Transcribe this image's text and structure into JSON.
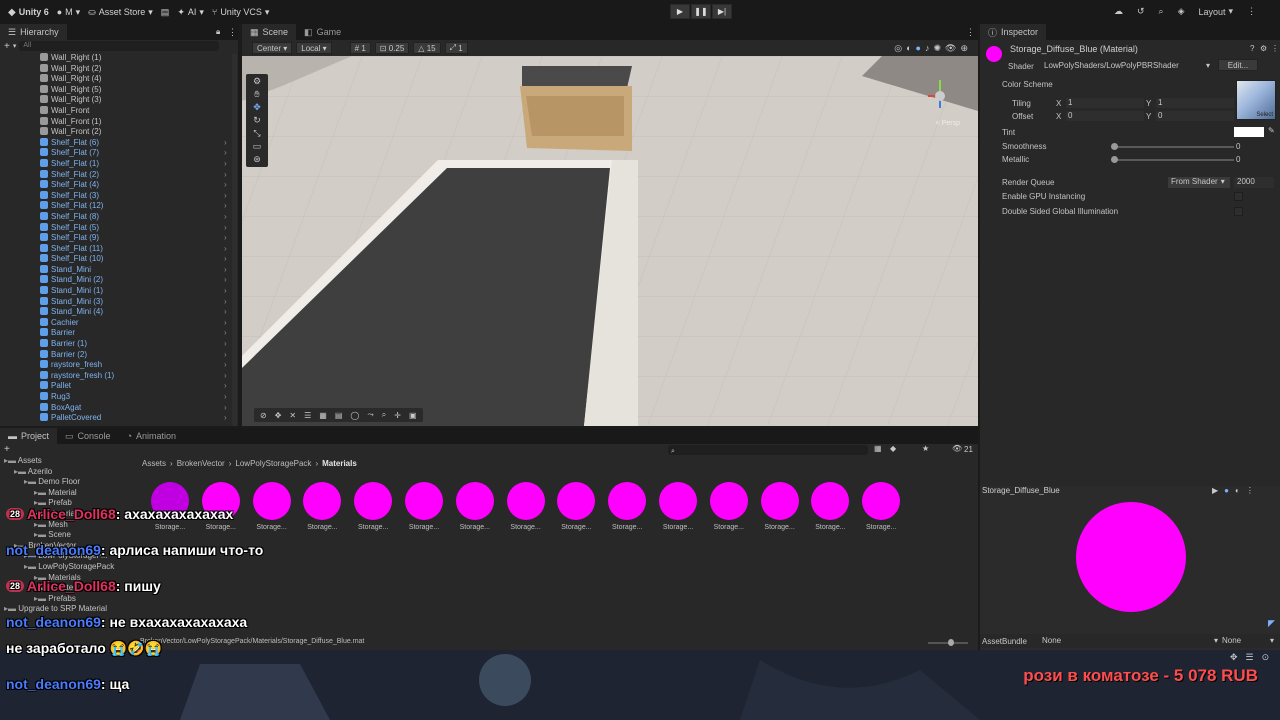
{
  "topbar": {
    "unity_label": "Unity 6",
    "account_label": "M",
    "asset_store_label": "Asset Store",
    "ai_label": "AI",
    "vcs_label": "Unity VCS",
    "layout_label": "Layout"
  },
  "hierarchy": {
    "tab": "Hierarchy",
    "search_placeholder": "All",
    "items": [
      {
        "label": "Wall_Right (1)",
        "type": "plain"
      },
      {
        "label": "Wall_Right (2)",
        "type": "plain"
      },
      {
        "label": "Wall_Right (4)",
        "type": "plain"
      },
      {
        "label": "Wall_Right (5)",
        "type": "plain"
      },
      {
        "label": "Wall_Right (3)",
        "type": "plain"
      },
      {
        "label": "Wall_Front",
        "type": "plain"
      },
      {
        "label": "Wall_Front (1)",
        "type": "plain"
      },
      {
        "label": "Wall_Front (2)",
        "type": "plain"
      },
      {
        "label": "Shelf_Flat (6)",
        "type": "prefab"
      },
      {
        "label": "Shelf_Flat (7)",
        "type": "prefab"
      },
      {
        "label": "Shelf_Flat (1)",
        "type": "prefab"
      },
      {
        "label": "Shelf_Flat (2)",
        "type": "prefab"
      },
      {
        "label": "Shelf_Flat (4)",
        "type": "prefab"
      },
      {
        "label": "Shelf_Flat (3)",
        "type": "prefab"
      },
      {
        "label": "Shelf_Flat (12)",
        "type": "prefab"
      },
      {
        "label": "Shelf_Flat (8)",
        "type": "prefab"
      },
      {
        "label": "Shelf_Flat (5)",
        "type": "prefab"
      },
      {
        "label": "Shelf_Flat (9)",
        "type": "prefab"
      },
      {
        "label": "Shelf_Flat (11)",
        "type": "prefab"
      },
      {
        "label": "Shelf_Flat (10)",
        "type": "prefab"
      },
      {
        "label": "Stand_Mini",
        "type": "prefab"
      },
      {
        "label": "Stand_Mini (2)",
        "type": "prefab"
      },
      {
        "label": "Stand_Mini (1)",
        "type": "prefab"
      },
      {
        "label": "Stand_Mini (3)",
        "type": "prefab"
      },
      {
        "label": "Stand_Mini (4)",
        "type": "prefab"
      },
      {
        "label": "Cachier",
        "type": "prefab"
      },
      {
        "label": "Barrier",
        "type": "prefab"
      },
      {
        "label": "Barrier (1)",
        "type": "prefab"
      },
      {
        "label": "Barrier (2)",
        "type": "prefab"
      },
      {
        "label": "raystore_fresh",
        "type": "prefab"
      },
      {
        "label": "raystore_fresh (1)",
        "type": "prefab"
      },
      {
        "label": "Pallet",
        "type": "prefab"
      },
      {
        "label": "Rug3",
        "type": "prefab"
      },
      {
        "label": "BoxAgat",
        "type": "prefab"
      },
      {
        "label": "PalletCovered",
        "type": "prefab"
      }
    ]
  },
  "scene": {
    "tab_scene": "Scene",
    "tab_game": "Game",
    "pivot": "Center",
    "space": "Local",
    "grid_value": "1",
    "snap_value": "0.25",
    "angle_value": "15",
    "scale_value": "1",
    "persp_label": "< Persp"
  },
  "inspector": {
    "tab": "Inspector",
    "title": "Storage_Diffuse_Blue (Material)",
    "shader_label": "Shader",
    "shader_value": "LowPolyShaders/LowPolyPBRShader",
    "edit_label": "Edit...",
    "color_scheme": "Color Scheme",
    "tiling": "Tiling",
    "offset": "Offset",
    "tiling_x": "1",
    "tiling_y": "1",
    "offset_x": "0",
    "offset_y": "0",
    "x_label": "X",
    "y_label": "Y",
    "select_label": "Select",
    "tint": "Tint",
    "smoothness": "Smoothness",
    "smoothness_val": "0",
    "metallic": "Metallic",
    "metallic_val": "0",
    "render_queue": "Render Queue",
    "render_queue_mode": "From Shader",
    "render_queue_val": "2000",
    "gpu_instancing": "Enable GPU Instancing",
    "double_sided": "Double Sided Global Illumination"
  },
  "project": {
    "tab_project": "Project",
    "tab_console": "Console",
    "tab_animation": "Animation",
    "count": "21",
    "breadcrumb": [
      "Assets",
      "BrokenVector",
      "LowPolyStoragePack",
      "Materials"
    ],
    "tree": [
      {
        "label": "Assets",
        "indent": 0
      },
      {
        "label": "Azerilo",
        "indent": 1
      },
      {
        "label": "Demo Floor",
        "indent": 2
      },
      {
        "label": "Material",
        "indent": 3
      },
      {
        "label": "Prefab",
        "indent": 3
      },
      {
        "label": "Material",
        "indent": 3
      },
      {
        "label": "Mesh",
        "indent": 3
      },
      {
        "label": "Scene",
        "indent": 3
      },
      {
        "label": "BrokenVector",
        "indent": 1
      },
      {
        "label": "LowPolyStorageP...",
        "indent": 2
      },
      {
        "label": "LowPolyStoragePack",
        "indent": 2
      },
      {
        "label": "Materials",
        "indent": 3
      },
      {
        "label": "Palettes",
        "indent": 3
      },
      {
        "label": "Prefabs",
        "indent": 3
      },
      {
        "label": "Upgrade to SRP Material",
        "indent": 0
      }
    ],
    "materials": [
      "Storage...",
      "Storage...",
      "Storage...",
      "Storage...",
      "Storage...",
      "Storage...",
      "Storage...",
      "Storage...",
      "Storage...",
      "Storage...",
      "Storage...",
      "Storage...",
      "Storage...",
      "Storage...",
      "Storage..."
    ],
    "path": "BrokenVector/LowPolyStoragePack/Materials/Storage_Diffuse_Blue.mat"
  },
  "preview": {
    "title": "Storage_Diffuse_Blue",
    "assetbundle_label": "AssetBundle",
    "assetbundle_value": "None",
    "variant_value": "None"
  },
  "chat": [
    {
      "badge": "28",
      "user": "Arlice_Doll68",
      "color": "red",
      "text": "ахахахахахахах"
    },
    {
      "badge": "",
      "user": "not_deanon69",
      "color": "blue",
      "text": "арлиса напиши что-то"
    },
    {
      "badge": "28",
      "user": "Arlice_Doll68",
      "color": "red",
      "text": "пишу"
    },
    {
      "badge": "",
      "user": "not_deanon69",
      "color": "blue",
      "text": "не вхахахахахахаха"
    },
    {
      "badge": "",
      "user": "",
      "color": "",
      "text": "не заработало 😭🤣😭"
    },
    {
      "badge": "",
      "user": "not_deanon69",
      "color": "blue",
      "text": "ща"
    }
  ],
  "donation": "рози в коматозе - 5 078 RUB",
  "colors": {
    "magenta": "#ff00ff",
    "prefab_blue": "#7fb4f0",
    "panel": "#282828",
    "donation_red": "#ff4d4d"
  }
}
